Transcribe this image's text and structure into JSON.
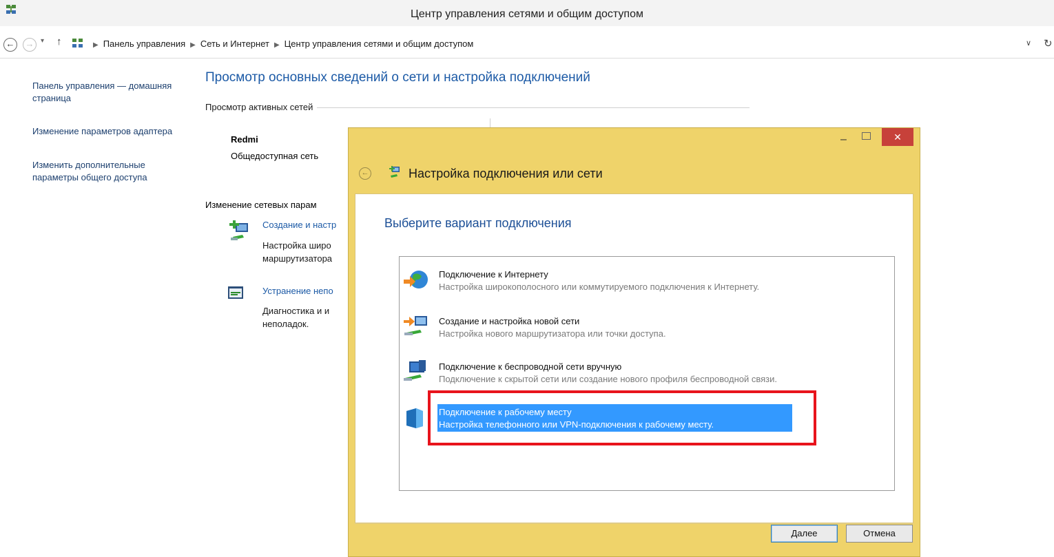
{
  "window": {
    "title": "Центр управления сетями и общим доступом"
  },
  "address": {
    "crumbs": [
      "Панель управления",
      "Сеть и Интернет",
      "Центр управления сетями и общим доступом"
    ],
    "back": "←",
    "forward": "→",
    "recent": "▾",
    "up": "↑",
    "dropdown": "∨",
    "refresh": "↻"
  },
  "sidebar": {
    "items": [
      {
        "label": "Панель управления — домашняя страница"
      },
      {
        "label": "Изменение параметров адаптера"
      },
      {
        "label": "Изменить дополнительные параметры общего доступа"
      }
    ]
  },
  "main": {
    "title": "Просмотр основных сведений о сети и настройка подключений",
    "active_networks_header": "Просмотр активных сетей",
    "network_name": "Redmi",
    "network_type": "Общедоступная сеть",
    "change_header": "Изменение сетевых парам",
    "create_link": "Создание и настр",
    "create_desc_1": "Настройка широ",
    "create_desc_2": "маршрутизатора",
    "trouble_link": "Устранение непо",
    "trouble_desc_1": "Диагностика и и",
    "trouble_desc_2": "неполадок."
  },
  "dialog": {
    "title": "Настройка подключения или сети",
    "heading": "Выберите вариант подключения",
    "minimize": "–",
    "close": "✕",
    "back": "←",
    "options": [
      {
        "title": "Подключение к Интернету",
        "desc": "Настройка широкополосного или коммутируемого подключения к Интернету.",
        "icon": "globe-network-icon"
      },
      {
        "title": "Создание и настройка новой сети",
        "desc": "Настройка нового маршрутизатора или точки доступа.",
        "icon": "new-network-icon"
      },
      {
        "title": "Подключение к беспроводной сети вручную",
        "desc": "Подключение к скрытой сети или создание нового профиля беспроводной связи.",
        "icon": "wireless-network-icon"
      },
      {
        "title": "Подключение к рабочему месту",
        "desc": "Настройка телефонного или VPN-подключения к рабочему месту.",
        "icon": "workplace-icon",
        "selected": true
      }
    ],
    "next_label": "Далее",
    "cancel_label": "Отмена"
  },
  "colors": {
    "dialog_frame": "#efd36a",
    "selection": "#3399ff",
    "link": "#1c5aa6",
    "close_button": "#c7413a",
    "highlight": "#e8141c"
  }
}
